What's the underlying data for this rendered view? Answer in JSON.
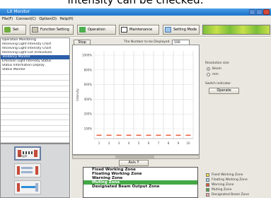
{
  "caption": "intensity can be checked.",
  "window": {
    "title": "LX Monitor"
  },
  "menu": [
    "File(F)",
    "Connect(C)",
    "Option(O)",
    "Help(H)"
  ],
  "toolbar": {
    "buttons": [
      {
        "label": "Set"
      },
      {
        "label": "Function Setting"
      },
      {
        "label": "Operation"
      },
      {
        "label": "Maintenance"
      },
      {
        "label": "Setting Mode"
      }
    ]
  },
  "tree": {
    "items": [
      "Operation Monitoring",
      "Receiving Light Intensity Chart",
      "Receiving Light Intensity Chart",
      "Receiving Light List (Individual)",
      "Tendency Monitor",
      "Emission Light Intensity Status",
      "Status Information Display",
      "Status Monitor"
    ],
    "selected_index": 4
  },
  "bottom_left": {
    "thumb_label": "Single"
  },
  "chart_controls": {
    "stop_label": "Stop",
    "measure_label": "The Number to be Displayed",
    "measure_value": "100",
    "axis_button": "Axis Y"
  },
  "chart_data": {
    "type": "bar",
    "ylabel": "Intensity",
    "y_ticks": [
      "1000%",
      "800%",
      "600%",
      "400%",
      "200%",
      "100%"
    ],
    "categories": [
      "1",
      "2",
      "3",
      "4",
      "5",
      "6",
      "7",
      "8",
      "9",
      "10"
    ],
    "values": [
      8,
      8,
      8,
      8,
      8,
      8,
      8,
      8,
      8,
      8
    ],
    "ylim": [
      0,
      1000
    ],
    "bar_color": "#e8603a"
  },
  "zones": [
    {
      "label": "Fixed Working Zone",
      "highlight": false
    },
    {
      "label": "Floating Working Zone",
      "highlight": false
    },
    {
      "label": "Warning Zone",
      "highlight": false
    },
    {
      "label": "Muting Zone",
      "highlight": true
    },
    {
      "label": "Designated Beam Output Zone",
      "highlight": false
    }
  ],
  "right_panel": {
    "resolution_label": "Resolution size",
    "radio_options": [
      {
        "label": "Beam",
        "checked": true
      },
      {
        "label": "mm",
        "checked": false
      }
    ],
    "switch_label": "Switch indicator",
    "switch_button": "Operate"
  },
  "legend": [
    {
      "label": "Fixed Working Zone",
      "color": "#f3e14b"
    },
    {
      "label": "Floating Working Zone",
      "color": "#9fd3f0"
    },
    {
      "label": "Warning Zone",
      "color": "#e0552f"
    },
    {
      "label": "Muting Zone",
      "color": "#4faa46"
    },
    {
      "label": "Designated Beam Zone",
      "color": "#f3a8a8"
    }
  ],
  "colors": {
    "selected": "#2c5ea8",
    "highlight_zone": "#43a845",
    "titlebar": "#1b6fc9"
  }
}
